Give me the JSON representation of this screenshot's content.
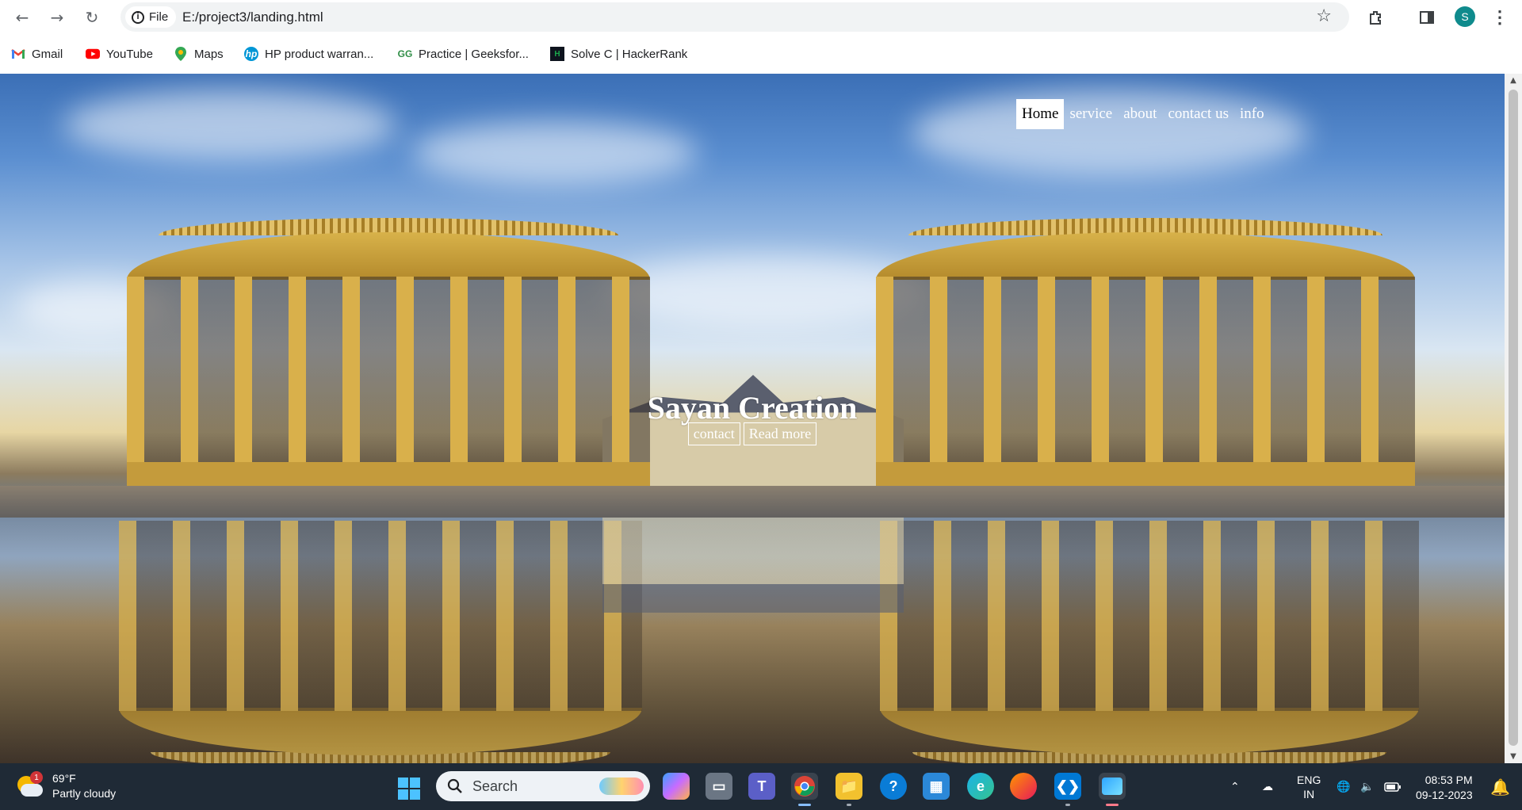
{
  "browser": {
    "site_chip": "File",
    "url": "E:/project3/landing.html",
    "profile_initial": "S"
  },
  "bookmarks": [
    {
      "label": "Gmail",
      "icon": "gmail-icon"
    },
    {
      "label": "YouTube",
      "icon": "youtube-icon"
    },
    {
      "label": "Maps",
      "icon": "maps-icon"
    },
    {
      "label": "HP product warran...",
      "icon": "hp-icon"
    },
    {
      "label": "Practice | Geeksfor...",
      "icon": "geeksforgeeks-icon"
    },
    {
      "label": "Solve C | HackerRank",
      "icon": "hackerrank-icon"
    }
  ],
  "page": {
    "nav": [
      "Home",
      "service",
      "about",
      "contact us",
      "info"
    ],
    "active_nav": "Home",
    "brand": "Sayan Creation",
    "buttons": {
      "contact": "contact",
      "read_more": "Read more"
    }
  },
  "taskbar": {
    "weather": {
      "badge": "1",
      "temp": "69°F",
      "desc": "Partly cloudy"
    },
    "search_placeholder": "Search",
    "language": {
      "line1": "ENG",
      "line2": "IN"
    },
    "time": "08:53 PM",
    "date": "09-12-2023"
  },
  "colors": {
    "taskbar_bg": "#1f2a36",
    "accent_blue": "#4cc2ff",
    "profile_bg": "#0f8b8d"
  }
}
